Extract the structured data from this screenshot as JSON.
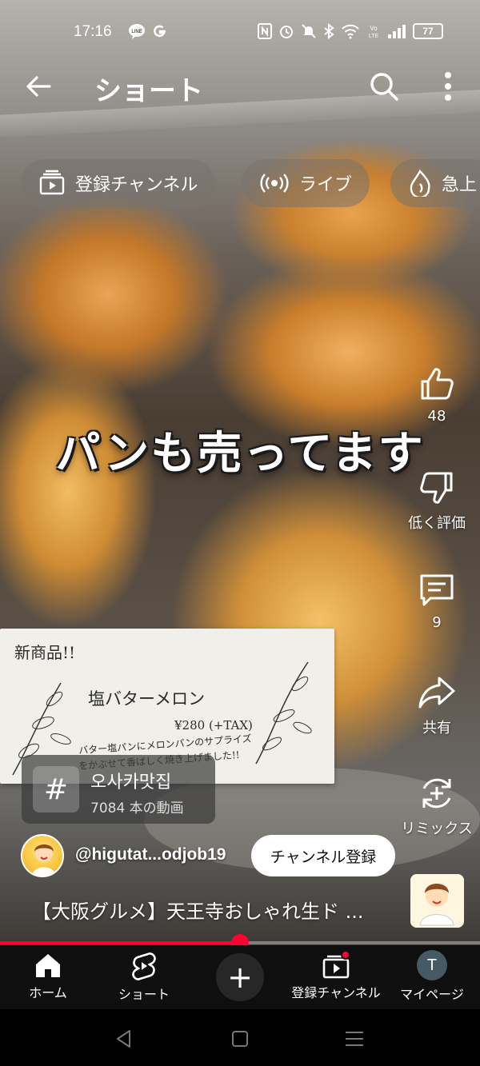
{
  "status_bar": {
    "time": "17:16",
    "battery": "77",
    "left_icons": [
      "line-icon",
      "google-icon"
    ],
    "right_icons": [
      "nfc-icon",
      "alarm-icon",
      "mute-icon",
      "bluetooth-icon",
      "wifi-icon",
      "volte-icon",
      "signal-icon",
      "battery-icon"
    ]
  },
  "header": {
    "title": "ショート",
    "back_icon": "arrow-left-icon",
    "search_icon": "search-icon",
    "more_icon": "more-vertical-icon"
  },
  "chips": [
    {
      "label": "登録チャンネル",
      "icon": "subscriptions-icon"
    },
    {
      "label": "ライブ",
      "icon": "live-icon"
    },
    {
      "label": "急上",
      "icon": "trending-icon"
    }
  ],
  "video": {
    "overlay_caption": "パンも売ってます",
    "price_card": {
      "line1": "新商品!!",
      "line2": "塩バターメロン",
      "line3": "¥280 (+TAX)",
      "line4": "バター塩パンにメロンパンのサプライズ",
      "line5": "をかぶせて香ばしく焼き上げました!!"
    }
  },
  "actions": {
    "like_count": "48",
    "dislike_label": "低く評価",
    "comment_count": "9",
    "share_label": "共有",
    "remix_label": "リミックス"
  },
  "hashtag": {
    "symbol": "#",
    "tag": "오사카맛집",
    "count": "7084 本の動画"
  },
  "channel": {
    "handle": "@higutat...odjob19",
    "subscribe_label": "チャンネル登録"
  },
  "video_title": "【大阪グルメ】天王寺おしゃれ生ド ...",
  "progress": {
    "fraction": 0.5
  },
  "bottom_nav": {
    "home": "ホーム",
    "shorts": "ショート",
    "create": "+",
    "subscriptions": "登録チャンネル",
    "mypage": "マイページ",
    "avatar_letter": "T"
  },
  "colors": {
    "accent_red": "#ff0033",
    "nav_bg": "#0f0f0f",
    "avatar_bg": "#455a64"
  }
}
